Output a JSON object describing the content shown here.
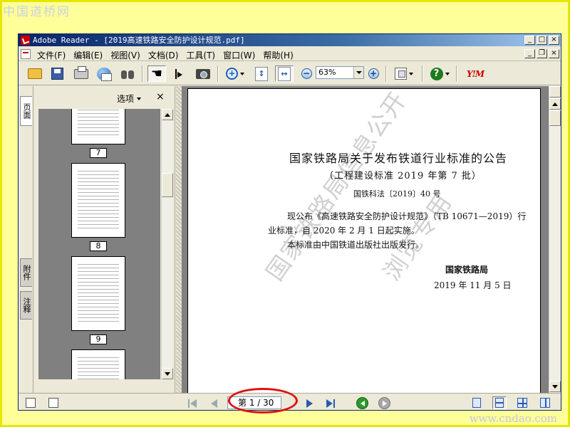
{
  "site": {
    "logo": "中国道桥网",
    "url": "www.cndao.com"
  },
  "window": {
    "title": "Adobe Reader - [2019高速铁路安全防护设计规范.pdf]"
  },
  "menu": [
    "文件(F)",
    "编辑(E)",
    "视图(V)",
    "文档(D)",
    "工具(T)",
    "窗口(W)",
    "帮助(H)"
  ],
  "toolbar": {
    "zoom_value": "63%",
    "icons": [
      "open-folder-icon",
      "save-icon",
      "print-icon",
      "email-icon",
      "search-binoculars-icon",
      "hand-tool-icon",
      "select-text-icon",
      "snapshot-camera-icon",
      "zoom-in-icon",
      "fit-page-icon",
      "fit-width-icon",
      "zoom-out-minus-icon",
      "zoom-in-plus-icon",
      "pages-icon",
      "help-icon",
      "yahoo-icon"
    ]
  },
  "side_tabs": {
    "pages": "页面",
    "attachments": "附件",
    "comments": "注释"
  },
  "panel": {
    "options": "选项",
    "close": "×"
  },
  "thumbnails": [
    {
      "label": "7"
    },
    {
      "label": "8"
    },
    {
      "label": "9"
    }
  ],
  "document": {
    "title": "国家铁路局关于发布铁道行业标准的公告",
    "subtitle": "（工程建设标准 2019 年第 7 批）",
    "doc_number": "国铁科法〔2019〕40 号",
    "body_line1": "现公布《高速铁路安全防护设计规范》（TB 10671—2019）行",
    "body_line2": "业标准，自 2020 年 2 月 1 日起实施。",
    "body_line3": "本标准由中国铁道出版社出版发行。",
    "organization": "国家铁路局",
    "date": "2019 年 11 月 5 日",
    "watermark_line1": "国家铁路局信息公开",
    "watermark_line2": "浏览专用"
  },
  "statusbar": {
    "page_indicator": "第 1 / 30 页"
  },
  "colors": {
    "highlight_circle": "#e01010",
    "page_background": "#ffff99"
  }
}
